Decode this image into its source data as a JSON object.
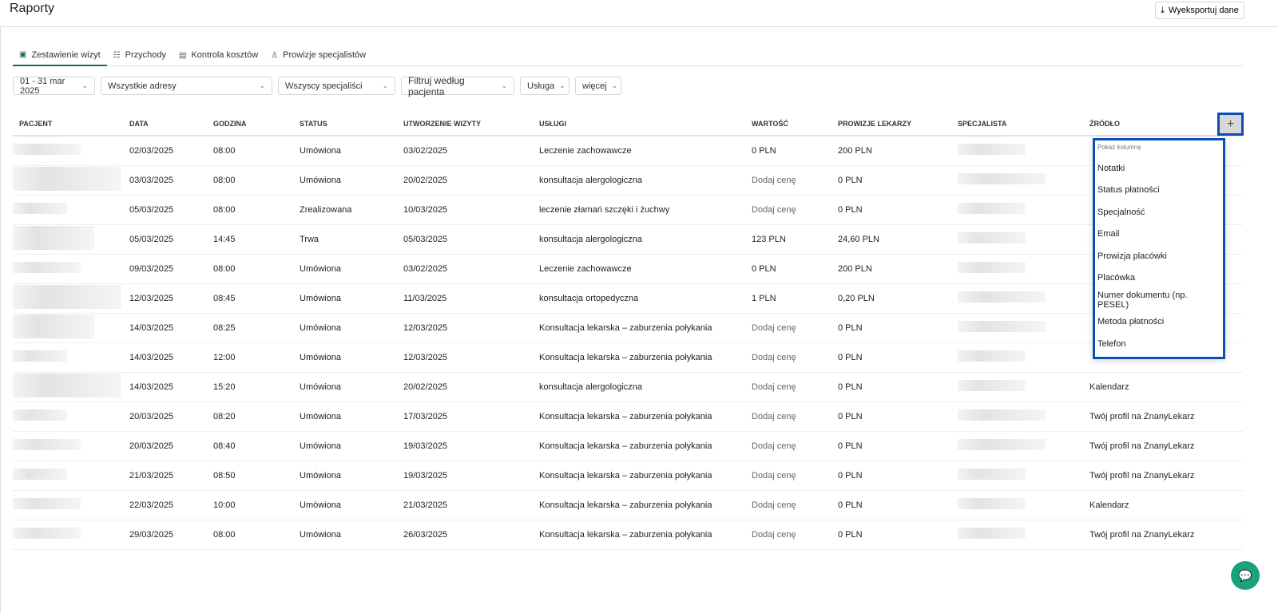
{
  "header": {
    "title": "Raporty",
    "export_label": "Wyeksportuj dane"
  },
  "tabs": [
    {
      "label": "Zestawienie wizyt",
      "icon": "calendar-icon",
      "glyph": "▣"
    },
    {
      "label": "Przychody",
      "icon": "list-icon",
      "glyph": "☷"
    },
    {
      "label": "Kontrola kosztów",
      "icon": "money-icon",
      "glyph": "▤"
    },
    {
      "label": "Prowizje specjalistów",
      "icon": "person-icon",
      "glyph": "♙"
    }
  ],
  "filters": {
    "date": "01 - 31 mar 2025",
    "address": "Wszystkie adresy",
    "specialist": "Wszyscy specjaliści",
    "patient": "Filtruj według pacjenta",
    "service": "Usługa",
    "more": "więcej"
  },
  "columns": [
    "PACJENT",
    "DATA",
    "GODZINA",
    "STATUS",
    "UTWORZENIE WIZYTY",
    "USŁUGI",
    "WARTOŚĆ",
    "PROWIZJE LEKARZY",
    "SPECJALISTA",
    "ŹRÓDŁO"
  ],
  "rows": [
    {
      "date": "02/03/2025",
      "time": "08:00",
      "status": "Umówiona",
      "created": "03/02/2025",
      "service": "Leczenie zachowawcze",
      "value": "0 PLN",
      "commission": "200 PLN",
      "source": ""
    },
    {
      "date": "03/03/2025",
      "time": "08:00",
      "status": "Umówiona",
      "created": "20/02/2025",
      "service": "konsultacja alergologiczna",
      "value": "Dodaj cenę",
      "commission": "0 PLN",
      "source": ""
    },
    {
      "date": "05/03/2025",
      "time": "08:00",
      "status": "Zrealizowana",
      "created": "10/03/2025",
      "service": "leczenie złamań szczęki i żuchwy",
      "value": "Dodaj cenę",
      "commission": "0 PLN",
      "source": ""
    },
    {
      "date": "05/03/2025",
      "time": "14:45",
      "status": "Trwa",
      "created": "05/03/2025",
      "service": "konsultacja alergologiczna",
      "value": "123 PLN",
      "commission": "24,60 PLN",
      "source": ""
    },
    {
      "date": "09/03/2025",
      "time": "08:00",
      "status": "Umówiona",
      "created": "03/02/2025",
      "service": "Leczenie zachowawcze",
      "value": "0 PLN",
      "commission": "200 PLN",
      "source": ""
    },
    {
      "date": "12/03/2025",
      "time": "08:45",
      "status": "Umówiona",
      "created": "11/03/2025",
      "service": "konsultacja ortopedyczna",
      "value": "1 PLN",
      "commission": "0,20 PLN",
      "source": ""
    },
    {
      "date": "14/03/2025",
      "time": "08:25",
      "status": "Umówiona",
      "created": "12/03/2025",
      "service": "Konsultacja lekarska – zaburzenia połykania",
      "value": "Dodaj cenę",
      "commission": "0 PLN",
      "source": ""
    },
    {
      "date": "14/03/2025",
      "time": "12:00",
      "status": "Umówiona",
      "created": "12/03/2025",
      "service": "Konsultacja lekarska – zaburzenia połykania",
      "value": "Dodaj cenę",
      "commission": "0 PLN",
      "source": ""
    },
    {
      "date": "14/03/2025",
      "time": "15:20",
      "status": "Umówiona",
      "created": "20/02/2025",
      "service": "konsultacja alergologiczna",
      "value": "Dodaj cenę",
      "commission": "0 PLN",
      "source": "Kalendarz"
    },
    {
      "date": "20/03/2025",
      "time": "08:20",
      "status": "Umówiona",
      "created": "17/03/2025",
      "service": "Konsultacja lekarska – zaburzenia połykania",
      "value": "Dodaj cenę",
      "commission": "0 PLN",
      "source": "Twój profil na ZnanyLekarz"
    },
    {
      "date": "20/03/2025",
      "time": "08:40",
      "status": "Umówiona",
      "created": "19/03/2025",
      "service": "Konsultacja lekarska – zaburzenia połykania",
      "value": "Dodaj cenę",
      "commission": "0 PLN",
      "source": "Twój profil na ZnanyLekarz"
    },
    {
      "date": "21/03/2025",
      "time": "08:50",
      "status": "Umówiona",
      "created": "19/03/2025",
      "service": "Konsultacja lekarska – zaburzenia połykania",
      "value": "Dodaj cenę",
      "commission": "0 PLN",
      "source": "Twój profil na ZnanyLekarz"
    },
    {
      "date": "22/03/2025",
      "time": "10:00",
      "status": "Umówiona",
      "created": "21/03/2025",
      "service": "Konsultacja lekarska – zaburzenia połykania",
      "value": "Dodaj cenę",
      "commission": "0 PLN",
      "source": "Kalendarz"
    },
    {
      "date": "29/03/2025",
      "time": "08:00",
      "status": "Umówiona",
      "created": "26/03/2025",
      "service": "Konsultacja lekarska – zaburzenia połykania",
      "value": "Dodaj cenę",
      "commission": "0 PLN",
      "source": "Twój profil na ZnanyLekarz"
    }
  ],
  "column_menu": {
    "header": "Pokaż kolumnę",
    "items": [
      "Notatki",
      "Status płatności",
      "Specjalność",
      "Email",
      "Prowizja placówki",
      "Placówka",
      "Numer dokumentu (np. PESEL)",
      "Metoda płatności",
      "Telefon"
    ]
  },
  "colors": {
    "accent": "#1d6b4f",
    "highlight": "#0b4fb5",
    "chat": "#1aa37a"
  }
}
